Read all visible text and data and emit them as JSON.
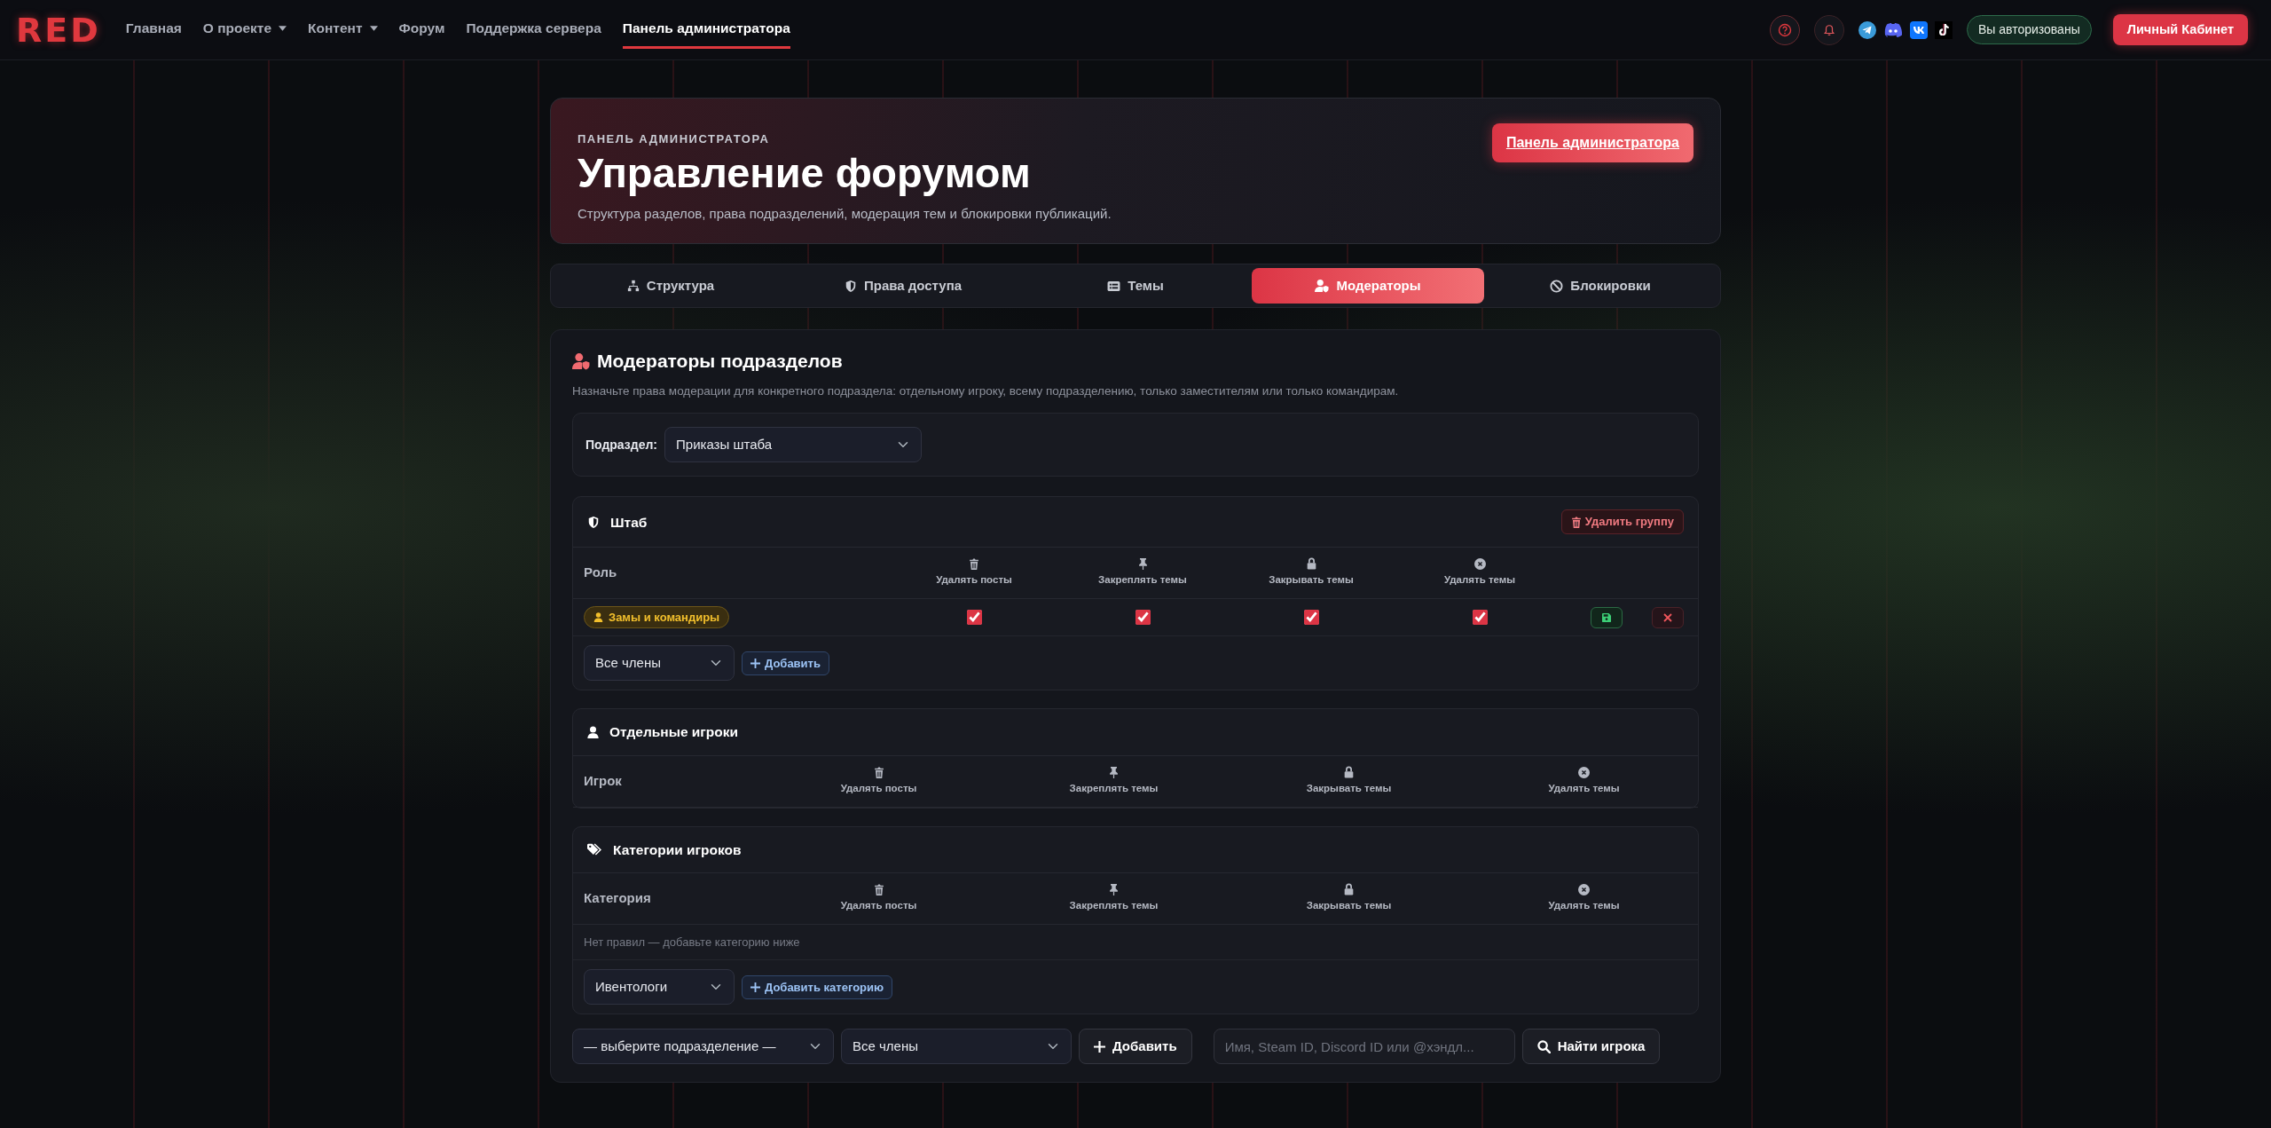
{
  "navbar": {
    "logo": "RED",
    "links": [
      {
        "label": "Главная",
        "dropdown": false,
        "selected": false
      },
      {
        "label": "О проекте",
        "dropdown": true,
        "selected": false
      },
      {
        "label": "Контент",
        "dropdown": true,
        "selected": false
      },
      {
        "label": "Форум",
        "dropdown": false,
        "selected": false
      },
      {
        "label": "Поддержка сервера",
        "dropdown": false,
        "selected": false
      },
      {
        "label": "Панель администратора",
        "dropdown": false,
        "selected": true
      }
    ],
    "auth_badge": "Вы авторизованы",
    "cabinet_button": "Личный Кабинет"
  },
  "header": {
    "eyebrow": "ПАНЕЛЬ АДМИНИСТРАТОРА",
    "title": "Управление форумом",
    "subtitle": "Структура разделов, права подразделений, модерация тем и блокировки публикаций.",
    "button": "Панель администратора"
  },
  "tabs": [
    {
      "label": "Структура",
      "selected": false
    },
    {
      "label": "Права доступа",
      "selected": false
    },
    {
      "label": "Темы",
      "selected": false
    },
    {
      "label": "Модераторы",
      "selected": true
    },
    {
      "label": "Блокировки",
      "selected": false
    }
  ],
  "moderators": {
    "title": "Модераторы подразделов",
    "description": "Назначьте права модерации для конкретного подраздела: отдельному игроку, всему подразделению, только заместителям или только командирам.",
    "subdivision_label": "Подраздел:",
    "subdivision_value": "Приказы штаба",
    "groups": [
      {
        "kind": "unit",
        "title": "Штаб",
        "delete_button": "Удалить группу",
        "first_column": "Роль",
        "permissions": [
          "Удалять посты",
          "Закреплять темы",
          "Закрывать темы",
          "Удалять темы"
        ],
        "rows": [
          {
            "role": "Замы и командиры",
            "checks": [
              {
                "checked": true
              },
              {
                "checked": true
              },
              {
                "checked": true
              },
              {
                "checked": true
              }
            ]
          }
        ],
        "add_select": "Все члены",
        "add_button": "Добавить"
      },
      {
        "kind": "players",
        "title": "Отдельные игроки",
        "first_column": "Игрок",
        "permissions": [
          "Удалять посты",
          "Закреплять темы",
          "Закрывать темы",
          "Удалять темы"
        ]
      },
      {
        "kind": "categories",
        "title": "Категории игроков",
        "first_column": "Категория",
        "permissions": [
          "Удалять посты",
          "Закреплять темы",
          "Закрывать темы",
          "Удалять темы"
        ],
        "empty_text": "Нет правил — добавьте категорию ниже",
        "add_select": "Ивентологи",
        "add_button": "Добавить категорию"
      }
    ],
    "bottom": {
      "subdivision_select": "— выберите подразделение —",
      "members_select": "Все члены",
      "add_button": "Добавить",
      "search_placeholder": "Имя, Steam ID, Discord ID или @хэндл...",
      "find_button": "Найти игрока"
    }
  }
}
